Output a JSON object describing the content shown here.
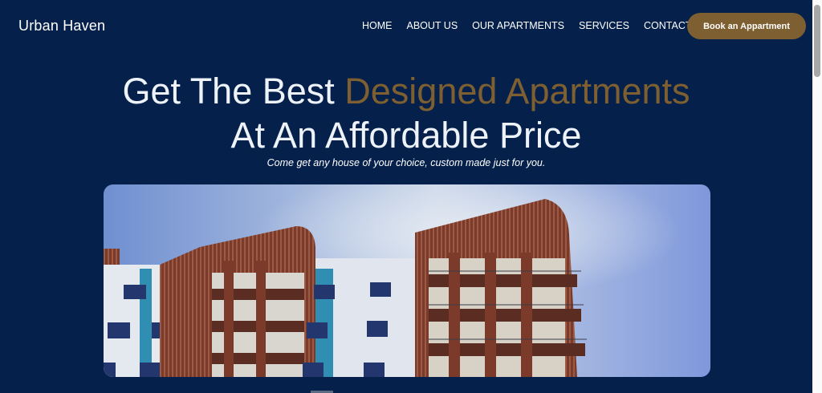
{
  "brand": {
    "name": "Urban Haven"
  },
  "nav": {
    "items": [
      "HOME",
      "ABOUT US",
      "OUR APARTMENTS",
      "SERVICES",
      "CONTACT US"
    ],
    "cta": "Book an Appartment"
  },
  "hero": {
    "line1_start": "Get The Best ",
    "line1_accent": "Designed Apartments",
    "line2": "At An Affordable Price",
    "subtitle": "Come get any house of your choice, custom made just for you."
  },
  "colors": {
    "background": "#05204a",
    "accent": "#7e5f31",
    "text": "#ffffff"
  }
}
